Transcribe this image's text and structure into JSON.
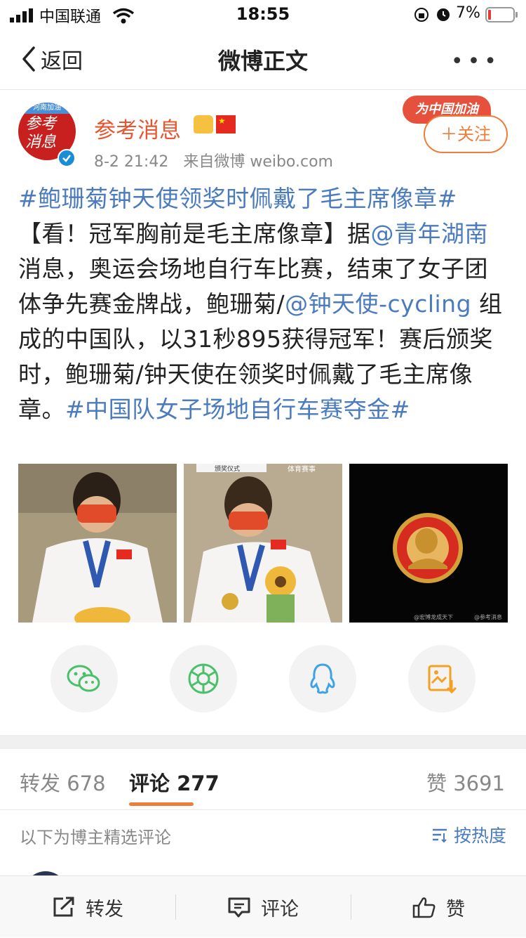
{
  "status_bar": {
    "carrier": "中国联通",
    "time": "18:55",
    "battery_percent": "7%"
  },
  "nav": {
    "back_label": "返回",
    "title": "微博正文"
  },
  "author": {
    "name": "参考消息",
    "avatar_text": "参考消息",
    "avatar_banner": "河南加油",
    "timestamp": "8-2 21:42",
    "source": "来自微博 weibo.com",
    "campaign_tag": "为中国加油",
    "follow_label": "＋关注"
  },
  "post": {
    "hashtag_title": "#鲍珊菊钟天使领奖时佩戴了毛主席像章#",
    "headline": "【看！冠军胸前是毛主席像章】",
    "t1": "据",
    "mention1": "@青年湖南",
    "t2": " 消息，奥运会场地自行车比赛，结束了女子团体争先赛金牌战，鲍珊菊/",
    "mention2": "@钟天使-cycling",
    "t3": " 组成的中国队，以31秒895获得冠军！赛后颁奖时，鲍珊菊/钟天使在领奖时佩戴了毛主席像章。",
    "hashtag_end": "#中国队女子场地自行车赛夺金#"
  },
  "images": [
    {
      "caption": ""
    },
    {
      "caption": "颁奖仪式",
      "overlay": "体育赛事"
    },
    {
      "watermark_left": "@宏博龙成天下",
      "watermark_right": "@参考消息"
    }
  ],
  "share_buttons": [
    {
      "icon": "wechat-icon",
      "color": "#4ac06b"
    },
    {
      "icon": "moments-icon",
      "color": "#4ac06b"
    },
    {
      "icon": "qq-icon",
      "color": "#3fa2e4"
    },
    {
      "icon": "save-image-icon",
      "color": "#f3a024"
    }
  ],
  "tabs": {
    "repost": {
      "label": "转发",
      "count": "678"
    },
    "comment": {
      "label": "评论",
      "count": "277"
    },
    "like": {
      "label": "赞",
      "count": "3691"
    }
  },
  "comments_section": {
    "note": "以下为博主精选评论",
    "sort_label": "按热度"
  },
  "bottom_bar": {
    "repost": "转发",
    "comment": "评论",
    "like": "赞"
  },
  "colors": {
    "accent": "#f07c3a",
    "link": "#4b7bbf",
    "author_name": "#e8552f"
  }
}
